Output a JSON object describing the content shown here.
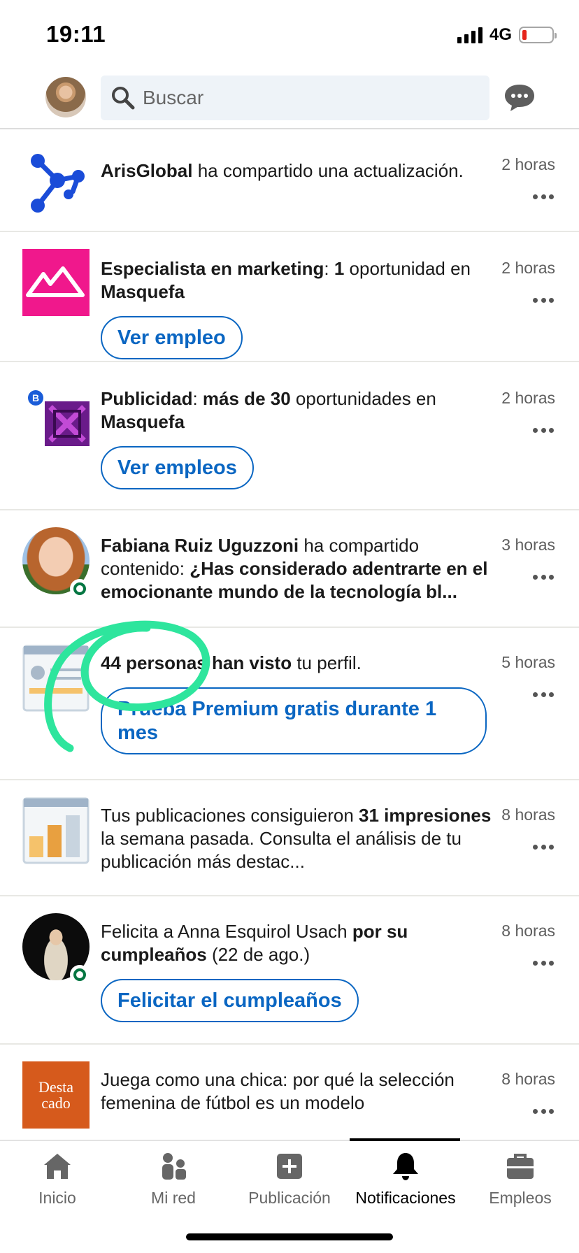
{
  "status": {
    "time": "19:11",
    "network": "4G"
  },
  "search": {
    "placeholder": "Buscar"
  },
  "notifications": [
    {
      "id": "arisglobal",
      "time": "2 horas",
      "parts": [
        {
          "b": true,
          "t": "ArisGlobal"
        },
        {
          "b": false,
          "t": " ha compartido una actualización."
        }
      ]
    },
    {
      "id": "marketing",
      "time": "2 horas",
      "button": "Ver empleo",
      "parts": [
        {
          "b": true,
          "t": "Especialista en marketing"
        },
        {
          "b": false,
          "t": ": "
        },
        {
          "b": true,
          "t": "1"
        },
        {
          "b": false,
          "t": " oportunidad en "
        },
        {
          "b": true,
          "t": "Masquefa"
        }
      ]
    },
    {
      "id": "publicidad",
      "time": "2 horas",
      "button": "Ver empleos",
      "badge": "B",
      "parts": [
        {
          "b": true,
          "t": "Publicidad"
        },
        {
          "b": false,
          "t": ": "
        },
        {
          "b": true,
          "t": "más de 30"
        },
        {
          "b": false,
          "t": " oportunidades en "
        },
        {
          "b": true,
          "t": "Masquefa"
        }
      ]
    },
    {
      "id": "fabiana",
      "time": "3 horas",
      "parts": [
        {
          "b": true,
          "t": "Fabiana Ruiz Uguzzoni"
        },
        {
          "b": false,
          "t": " ha compartido contenido: "
        },
        {
          "b": true,
          "t": "¿Has considerado adentrarte en el emocionante mundo de la tecnología bl..."
        }
      ]
    },
    {
      "id": "profile-views",
      "time": "5 horas",
      "button": "Prueba Premium gratis durante 1 mes",
      "parts": [
        {
          "b": true,
          "t": "44 personas han visto"
        },
        {
          "b": false,
          "t": " tu perfil."
        }
      ]
    },
    {
      "id": "impressions",
      "time": "8 horas",
      "parts": [
        {
          "b": false,
          "t": "Tus publicaciones consiguieron "
        },
        {
          "b": true,
          "t": "31 impresiones"
        },
        {
          "b": false,
          "t": " la semana pasada. Consulta el análisis de tu publicación más destac..."
        }
      ]
    },
    {
      "id": "birthday",
      "time": "8 horas",
      "button": "Felicitar el cumpleaños",
      "parts": [
        {
          "b": false,
          "t": "Felicita a Anna Esquirol Usach "
        },
        {
          "b": true,
          "t": "por su cumpleaños"
        },
        {
          "b": false,
          "t": " (22 de ago.)"
        }
      ]
    },
    {
      "id": "destacado",
      "time": "8 horas",
      "thumb_text": "Desta cado",
      "parts": [
        {
          "b": false,
          "t": "Juega como una chica: por qué la selección femenina de fútbol es un modelo"
        }
      ]
    }
  ],
  "nav": [
    {
      "label": "Inicio",
      "icon": "home-icon"
    },
    {
      "label": "Mi red",
      "icon": "network-icon"
    },
    {
      "label": "Publicación",
      "icon": "post-icon"
    },
    {
      "label": "Notificaciones",
      "icon": "bell-icon",
      "active": true
    },
    {
      "label": "Empleos",
      "icon": "briefcase-icon"
    }
  ],
  "colors": {
    "accent": "#0a66c2",
    "highlight": "#2ee59d",
    "presence": "#057642"
  }
}
